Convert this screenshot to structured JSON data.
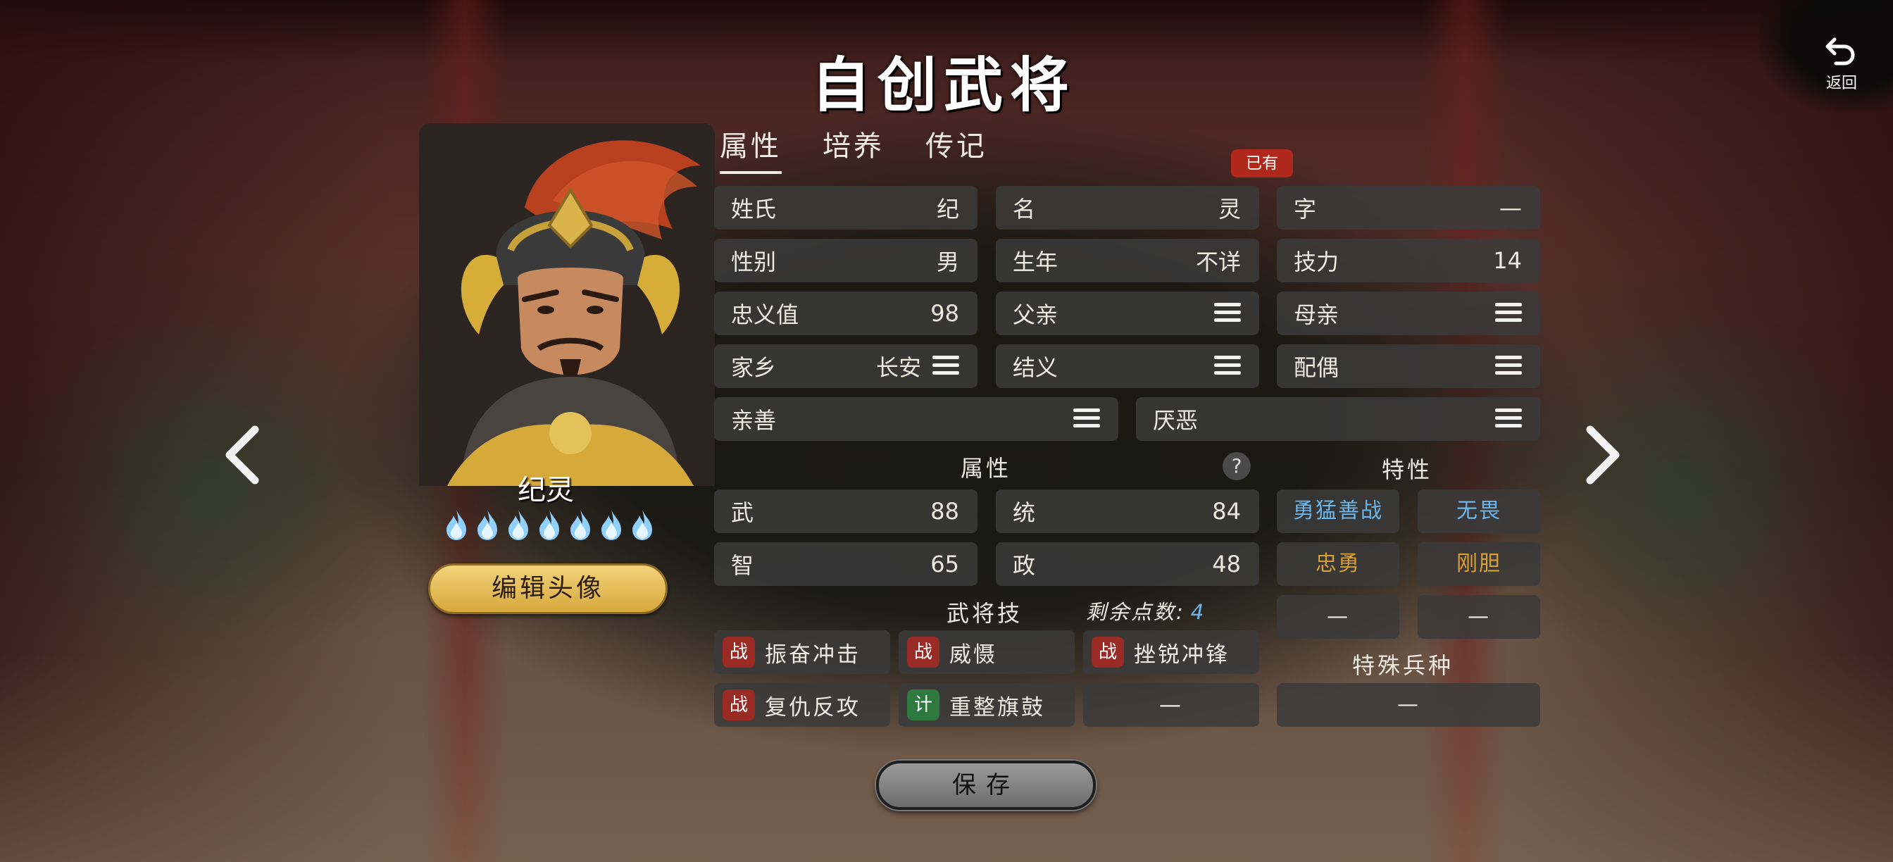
{
  "title": "自创武将",
  "return_label": "返回",
  "tabs": [
    {
      "label": "属性",
      "active": true
    },
    {
      "label": "培养",
      "active": false
    },
    {
      "label": "传记",
      "active": false
    }
  ],
  "owned_badge": "已有",
  "hero": {
    "name": "纪灵",
    "flame_count": 7,
    "edit_avatar_label": "编辑头像"
  },
  "fields": {
    "surname": {
      "label": "姓氏",
      "value": "纪"
    },
    "given_name": {
      "label": "名",
      "value": "灵"
    },
    "courtesy": {
      "label": "字",
      "value": "—"
    },
    "gender": {
      "label": "性别",
      "value": "男"
    },
    "birth_year": {
      "label": "生年",
      "value": "不详"
    },
    "skill_power": {
      "label": "技力",
      "value": "14"
    },
    "loyalty": {
      "label": "忠义值",
      "value": "98"
    },
    "father": {
      "label": "父亲"
    },
    "mother": {
      "label": "母亲"
    },
    "hometown": {
      "label": "家乡",
      "value": "长安"
    },
    "sworn": {
      "label": "结义"
    },
    "spouse": {
      "label": "配偶"
    },
    "likes": {
      "label": "亲善"
    },
    "dislikes": {
      "label": "厌恶"
    }
  },
  "attributes": {
    "section_label": "属性",
    "help": "?",
    "war": {
      "label": "武",
      "value": "88"
    },
    "lead": {
      "label": "统",
      "value": "84"
    },
    "intel": {
      "label": "智",
      "value": "65"
    },
    "politics": {
      "label": "政",
      "value": "48"
    }
  },
  "traits": {
    "section_label": "特性",
    "items": [
      "勇猛善战",
      "无畏",
      "忠勇",
      "刚胆",
      "—",
      "—"
    ]
  },
  "skills": {
    "section_label": "武将技",
    "remaining_label": "剩余点数:",
    "remaining_value": "4",
    "items": [
      {
        "tag": "战",
        "name": "振奋冲击"
      },
      {
        "tag": "战",
        "name": "威慑"
      },
      {
        "tag": "战",
        "name": "挫锐冲锋"
      },
      {
        "tag": "战",
        "name": "复仇反攻"
      },
      {
        "tag": "计",
        "name": "重整旗鼓"
      },
      {
        "tag": "",
        "name": "—"
      }
    ]
  },
  "special_troop": {
    "section_label": "特殊兵种",
    "value": "—"
  },
  "save_label": "保存",
  "colors": {
    "trait_blue": "#6bb6ec",
    "trait_gold": "#d9a032",
    "war_tag": "#9a2a24",
    "plan_tag": "#2e7a3e",
    "badge_red": "#b0281c",
    "avatar_button": "#e6bd5a"
  }
}
